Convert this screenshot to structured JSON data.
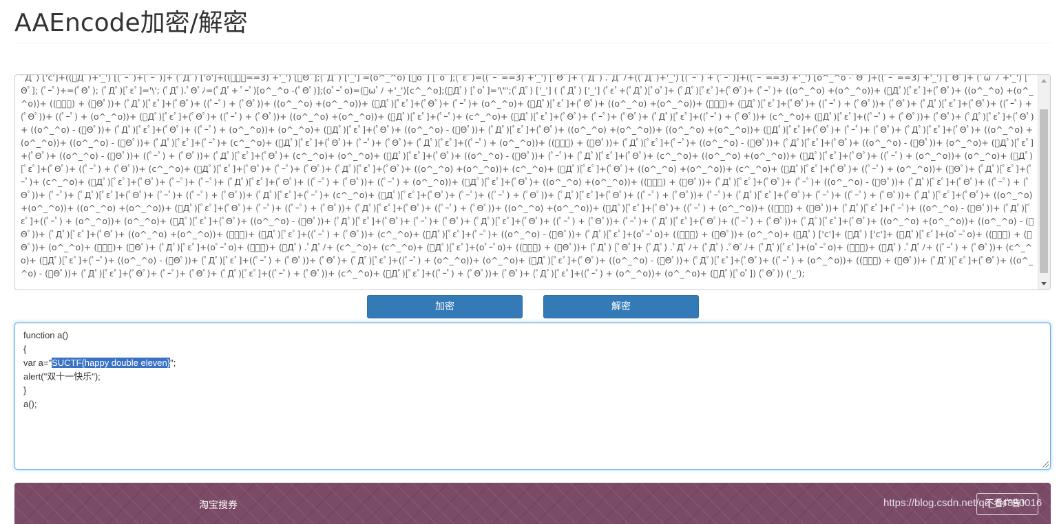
{
  "page": {
    "title": "AAEncode加密/解密"
  },
  "input": {
    "encoded_text": "ﾟДﾟ) ['c']+((ﾟДﾟ)+'_') [(ﾟｰﾟ)+(ﾟｰﾟ)]+ (ﾟДﾟ) ['o']+((ﾟｰﾟ==3) +'_') [ﾟΘﾟ];(ﾟДﾟ) ['_'] =(o^_^o) [ﾟoﾟ] [ﾟoﾟ];(ﾟεﾟ)=((ﾟｰﾟ==3) +'_') [ﾟΘﾟ]+ (ﾟДﾟ) .ﾟДﾟﾉ+((ﾟДﾟ)+'_') [(ﾟｰﾟ) + (ﾟｰﾟ)]+((ﾟｰﾟ==3) +'_') [o^_^o -ﾟΘﾟ]+((ﾟｰﾟ==3) +'_') [ﾟΘﾟ]+ (ﾟωﾟﾉ +'_') [ﾟΘﾟ]; (ﾟｰﾟ)+=(ﾟΘﾟ); (ﾟДﾟ)[ﾟεﾟ]='\\'; (ﾟДﾟ).ﾟΘﾟﾉ=(ﾟДﾟ+ ﾟｰﾟ)[o^_^o -(ﾟΘﾟ)];(oﾟｰﾟo)=(ﾟωﾟﾉ +'_')[c^_^o];(ﾟДﾟ) [ﾟoﾟ]='\\\"';(ﾟДﾟ) ['_'] ( (ﾟДﾟ) ['_'] (ﾟεﾟ+(ﾟДﾟ)[ﾟoﾟ]+ (ﾟДﾟ)[ﾟεﾟ]+(ﾟΘﾟ)+ (ﾟｰﾟ)+ ((o^_^o) +(o^_^o))+ (ﾟДﾟ)[ﾟεﾟ]+(ﾟΘﾟ)+ ((o^_^o) +(o^_^o))+ ((ﾟｰﾟ) + (ﾟΘﾟ))+ (ﾟДﾟ)[ﾟεﾟ]+(ﾟΘﾟ)+ ((ﾟｰﾟ) + (ﾟΘﾟ))+ ((o^_^o) +(o^_^o))+ (ﾟДﾟ)[ﾟεﾟ]+(ﾟΘﾟ)+ (ﾟｰﾟ)+ (o^_^o)+ (ﾟДﾟ)[ﾟεﾟ]+(ﾟΘﾟ)+ ((o^_^o) +(o^_^o))+ (ﾟｰﾟ)+ (ﾟДﾟ)[ﾟεﾟ]+(ﾟΘﾟ)+ ((ﾟｰﾟ) + (ﾟΘﾟ))+ (ﾟΘﾟ)+ (ﾟДﾟ)[ﾟεﾟ]+(ﾟΘﾟ)+ ((ﾟｰﾟ) + (ﾟΘﾟ))+ ((ﾟｰﾟ) + (o^_^o))+ (ﾟДﾟ)[ﾟεﾟ]+(ﾟΘﾟ)+ ((ﾟｰﾟ) + (ﾟΘﾟ))+ ((o^_^o) +(o^_^o))+ (ﾟДﾟ)[ﾟεﾟ]+(ﾟｰﾟ)+ (c^_^o)+ (ﾟДﾟ)[ﾟεﾟ]+(ﾟΘﾟ)+ (ﾟｰﾟ)+ (ﾟΘﾟ)+ (ﾟДﾟ)[ﾟεﾟ]+((ﾟｰﾟ) + (ﾟΘﾟ))+ (c^_^o)+ (ﾟДﾟ)[ﾟεﾟ]+((ﾟｰﾟ) + (ﾟΘﾟ))+ (ﾟΘﾟ)+ (ﾟДﾟ)[ﾟεﾟ]+(ﾟΘﾟ)+ ((o^_^o) - (ﾟΘﾟ))+ (ﾟДﾟ)[ﾟεﾟ]+(ﾟΘﾟ)+ ((ﾟｰﾟ) + (o^_^o))+ (o^_^o)+ (ﾟДﾟ)[ﾟεﾟ]+(ﾟΘﾟ)+ ((o^_^o) - (ﾟΘﾟ))+ (ﾟДﾟ)[ﾟεﾟ]+(ﾟΘﾟ)+ ((o^_^o) +(o^_^o))+ ((o^_^o) +(o^_^o))+ (ﾟДﾟ)[ﾟεﾟ]+(ﾟΘﾟ)+ (ﾟｰﾟ)+ (ﾟΘﾟ)+ (ﾟДﾟ)[ﾟεﾟ]+(ﾟΘﾟ)+ ((o^_^o) +(o^_^o))+ ((o^_^o) - (ﾟΘﾟ))+ (ﾟДﾟ)[ﾟεﾟ]+(ﾟｰﾟ)+ (c^_^o)+ (ﾟДﾟ)[ﾟεﾟ]+(ﾟΘﾟ)+ (ﾟｰﾟ)+ (ﾟΘﾟ)+ (ﾟДﾟ)[ﾟεﾟ]+((ﾟｰﾟ) + (o^_^o))+ ((ﾟｰﾟ) + (ﾟΘﾟ))+ (ﾟДﾟ)[ﾟεﾟ]+(ﾟｰﾟ)+ ((o^_^o) - (ﾟΘﾟ))+ (ﾟДﾟ)[ﾟεﾟ]+(ﾟΘﾟ)+ ((o^_^o) - (ﾟΘﾟ))+ (o^_^o)+ (ﾟДﾟ)[ﾟεﾟ]+(ﾟΘﾟ)+ ((o^_^o) - (ﾟΘﾟ))+ ((ﾟｰﾟ) + (ﾟΘﾟ))+ (ﾟДﾟ)[ﾟεﾟ]+(ﾟΘﾟ)+ (c^_^o)+ (o^_^o)+ (ﾟДﾟ)[ﾟεﾟ]+(ﾟΘﾟ)+ ((o^_^o) - (ﾟΘﾟ))+ (ﾟｰﾟ)+ (ﾟДﾟ)[ﾟεﾟ]+(ﾟΘﾟ)+ (c^_^o)+ ((o^_^o) +(o^_^o))+ (ﾟДﾟ)[ﾟεﾟ]+(ﾟΘﾟ)+ ((ﾟｰﾟ) + (o^_^o))+ (o^_^o)+ (ﾟДﾟ)[ﾟεﾟ]+(ﾟΘﾟ)+ ((ﾟｰﾟ) + (ﾟΘﾟ))+ (c^_^o)+ (ﾟДﾟ)[ﾟεﾟ]+(ﾟΘﾟ)+ (ﾟｰﾟ)+ (ﾟΘﾟ)+ (ﾟДﾟ)[ﾟεﾟ]+(ﾟΘﾟ)+ ((o^_^o) +(o^_^o))+ (c^_^o)+ (ﾟДﾟ)[ﾟεﾟ]+(ﾟΘﾟ)+ ((o^_^o) +(o^_^o))+ (c^_^o)+ (ﾟДﾟ)[ﾟεﾟ]+(ﾟΘﾟ)+ ((ﾟｰﾟ) + (o^_^o))+ (ﾟΘﾟ)+ (ﾟДﾟ)[ﾟεﾟ]+(ﾟｰﾟ)+ (c^_^o)+ (ﾟДﾟ)[ﾟεﾟ]+(ﾟΘﾟ)+ (ﾟｰﾟ)+ (ﾟｰﾟ)+ (ﾟДﾟ)[ﾟεﾟ]+(ﾟΘﾟ)+ ((ﾟｰﾟ) + (ﾟΘﾟ))+ ((ﾟｰﾟ) + (o^_^o))+ (ﾟДﾟ)[ﾟεﾟ]+(ﾟΘﾟ)+ ((o^_^o) +(o^_^o))+ ((ﾟｰﾟ) + (ﾟΘﾟ))+ (ﾟДﾟ)[ﾟεﾟ]+(ﾟΘﾟ)+ (ﾟｰﾟ)+ ((o^_^o) - (ﾟΘﾟ))+ (ﾟДﾟ)[ﾟεﾟ]+(ﾟΘﾟ)+ ((ﾟｰﾟ) + (ﾟΘﾟ))+ (ﾟｰﾟ)+ (ﾟДﾟ)[ﾟεﾟ]+(ﾟΘﾟ)+ (ﾟｰﾟ)+ ((ﾟｰﾟ) + (ﾟΘﾟ))+ (ﾟДﾟ)[ﾟεﾟ]+(ﾟｰﾟ)+ (c^_^o)+ (ﾟДﾟ)[ﾟεﾟ]+(ﾟΘﾟ)+ (ﾟｰﾟ)+ ((ﾟｰﾟ) + (ﾟΘﾟ))+ (ﾟДﾟ)[ﾟεﾟ]+(ﾟΘﾟ)+ ((ﾟｰﾟ) + (ﾟΘﾟ))+ (ﾟｰﾟ)+ (ﾟДﾟ)[ﾟεﾟ]+(ﾟΘﾟ)+ (ﾟｰﾟ)+ ((ﾟｰﾟ) + (ﾟΘﾟ))+ (ﾟДﾟ)[ﾟεﾟ]+(ﾟΘﾟ)+ ((o^_^o) +(o^_^o))+ ((o^_^o) +(o^_^o))+ (ﾟДﾟ)[ﾟεﾟ]+(ﾟΘﾟ)+ (ﾟｰﾟ)+ ((ﾟｰﾟ) + (ﾟΘﾟ))+ (ﾟДﾟ)[ﾟεﾟ]+(ﾟΘﾟ)+ ((ﾟｰﾟ) + (ﾟΘﾟ))+ ((o^_^o) +(o^_^o))+ (ﾟДﾟ)[ﾟεﾟ]+(ﾟΘﾟ)+ ((ﾟｰﾟ) + (o^_^o))+ ((ﾟｰﾟ) + (ﾟΘﾟ))+ (ﾟДﾟ)[ﾟεﾟ]+(ﾟｰﾟ)+ ((o^_^o) - (ﾟΘﾟ))+ (ﾟДﾟ)[ﾟεﾟ]+((ﾟｰﾟ) + (o^_^o))+ (o^_^o)+ (ﾟДﾟ)[ﾟεﾟ]+(ﾟΘﾟ)+ ((o^_^o) - (ﾟΘﾟ))+ (ﾟДﾟ)[ﾟεﾟ]+(ﾟΘﾟ)+ (ﾟｰﾟ)+ (ﾟΘﾟ)+ (ﾟДﾟ)[ﾟεﾟ]+(ﾟΘﾟ)+ ((ﾟｰﾟ) + (ﾟΘﾟ))+ (ﾟｰﾟ)+ (ﾟДﾟ)[ﾟεﾟ]+(ﾟΘﾟ)+ ((ﾟｰﾟ) + (ﾟΘﾟ))+ (ﾟДﾟ)[ﾟεﾟ]+(ﾟΘﾟ)+ ((o^_^o) +(o^_^o))+ ((o^_^o) - (ﾟΘﾟ))+ (ﾟДﾟ)[ﾟεﾟ]+(ﾟΘﾟ)+ ((o^_^o) +(o^_^o))+ (ﾟｰﾟ)+ (ﾟДﾟ)[ﾟεﾟ]+((ﾟｰﾟ) + (ﾟΘﾟ))+ (c^_^o)+ (ﾟДﾟ)[ﾟεﾟ]+(ﾟｰﾟ)+ ((o^_^o) - (ﾟΘﾟ))+ (ﾟДﾟ)[ﾟεﾟ]+(oﾟｰﾟo)+ ((ﾟｰﾟ) + (ﾟΘﾟ))+ (o^_^o)+ (ﾟДﾟ) ['c']+ (ﾟДﾟ) ['c']+ (ﾟДﾟ)[ﾟεﾟ]+(oﾟｰﾟo)+ ((ﾟｰﾟ) + (ﾟΘﾟ))+ (o^_^o)+ (ﾟｰﾟ)+ (ﾟΘﾟ)+ (ﾟДﾟ)[ﾟεﾟ]+(oﾟｰﾟo)+ (ﾟｰﾟ)+ (ﾟДﾟ) .ﾟДﾟﾉ+ (c^_^o)+ (c^_^o)+ (ﾟДﾟ)[ﾟεﾟ]+(oﾟｰﾟo)+ ((ﾟｰﾟ) + (ﾟΘﾟ))+ (ﾟДﾟ) [ﾟΘﾟ]+ (ﾟДﾟ) .ﾟДﾟﾉ+ (ﾟДﾟ) .ﾟΘﾟﾉ+ (ﾟДﾟ)[ﾟεﾟ]+(oﾟｰﾟo)+ (ﾟｰﾟ)+ (ﾟДﾟ) .ﾟДﾟﾉ+ ((ﾟｰﾟ) + (ﾟΘﾟ))+ (c^_^o)+ (ﾟДﾟ)[ﾟεﾟ]+(ﾟｰﾟ)+ ((o^_^o) - (ﾟΘﾟ))+ (ﾟДﾟ)[ﾟεﾟ]+((ﾟｰﾟ) + (ﾟΘﾟ))+ (ﾟΘﾟ)+ (ﾟДﾟ)[ﾟεﾟ]+((ﾟｰﾟ) + (o^_^o))+ (o^_^o)+ (ﾟДﾟ)[ﾟεﾟ]+(ﾟΘﾟ)+ ((o^_^o) - (ﾟΘﾟ))+ (ﾟДﾟ)[ﾟεﾟ]+(ﾟΘﾟ)+ ((ﾟｰﾟ) + (o^_^o))+ ((ﾟｰﾟ) + (ﾟΘﾟ))+ (ﾟДﾟ)[ﾟεﾟ]+(ﾟΘﾟ)+ ((o^_^o) - (ﾟΘﾟ))+ (ﾟДﾟ)[ﾟεﾟ]+(ﾟΘﾟ)+ (ﾟｰﾟ)+ (ﾟΘﾟ)+ (ﾟДﾟ)[ﾟεﾟ]+((ﾟｰﾟ) + (ﾟΘﾟ))+ (c^_^o)+ (ﾟДﾟ)[ﾟεﾟ]+((ﾟｰﾟ) + (ﾟΘﾟ))+ (ﾟΘﾟ)+ (ﾟДﾟ)[ﾟεﾟ]+((ﾟｰﾟ) + (o^_^o))+ (o^_^o)+ (ﾟДﾟ)[ﾟoﾟ]) (ﾟΘﾟ)) ('_');"
  },
  "buttons": {
    "encrypt_label": "加密",
    "decrypt_label": "解密"
  },
  "output": {
    "lines": {
      "l1": "function a()",
      "l2": "{",
      "l3_prefix": "var a=\"",
      "l3_selected": "SUCTF{happy double eleven}",
      "l3_suffix": "\";",
      "l4": "alert(\"双十一快乐\");",
      "l5": "}",
      "l6": "a();"
    }
  },
  "banner": {
    "link_label": "淘宝搜券",
    "watermark": "https://blog.csdn.net/qq_54890016",
    "hide_ad_label": "不看广告！"
  },
  "colors": {
    "primary_button": "#337ab7",
    "selection": "#3a73c5",
    "banner_bg": "#7a4a66"
  }
}
